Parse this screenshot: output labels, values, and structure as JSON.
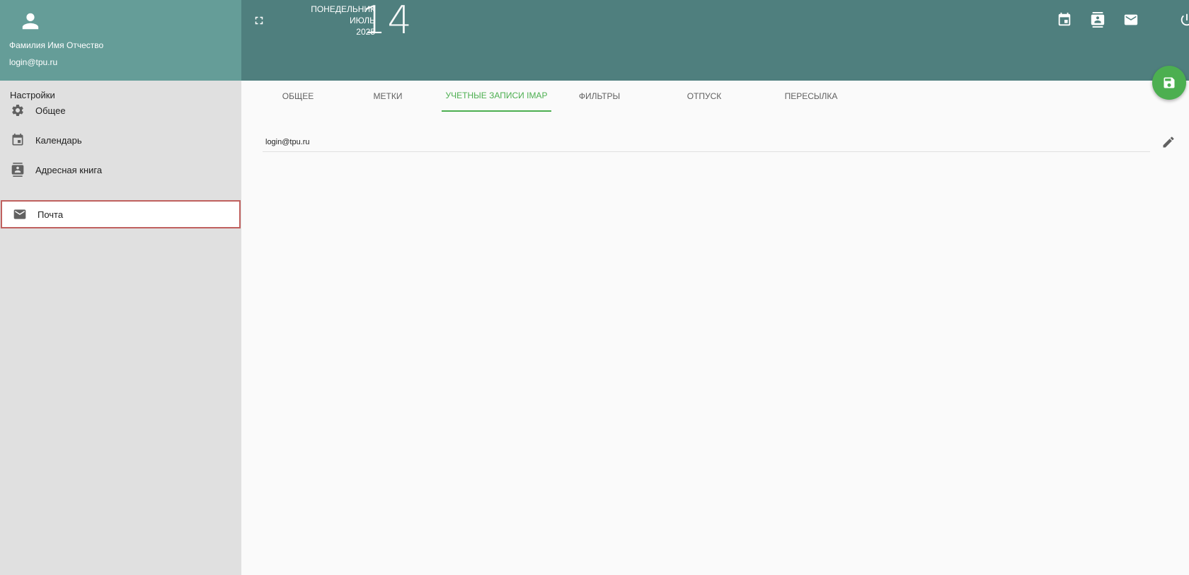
{
  "user": {
    "full_name": "Фамилия Имя Отчество",
    "login": "login@tpu.ru"
  },
  "header": {
    "weekday": "Понедельник",
    "month": "Июль",
    "year": "2025",
    "day": "14",
    "icons": [
      "calendar-icon",
      "address-book-icon",
      "mail-icon",
      "power-icon"
    ]
  },
  "sidebar": {
    "title": "Настройки",
    "items": [
      {
        "label": "Общее",
        "icon": "gear-icon"
      },
      {
        "label": "Календарь",
        "icon": "calendar-icon"
      },
      {
        "label": "Адресная книга",
        "icon": "address-book-icon"
      },
      {
        "label": "Почта",
        "icon": "mail-icon",
        "active": true
      }
    ]
  },
  "tabs": [
    {
      "label": "Общее"
    },
    {
      "label": "Метки"
    },
    {
      "label": "Учетные записи IMAP",
      "active": true
    },
    {
      "label": "Фильтры"
    },
    {
      "label": "Отпуск"
    },
    {
      "label": "Пересылка"
    }
  ],
  "accounts": [
    {
      "email": "login@tpu.ru"
    }
  ],
  "colors": {
    "header": "#4f7f7e",
    "user_panel": "#659d98",
    "accent": "#4caf50",
    "sidebar_bg": "#e0e0e0",
    "active_outline": "#c0605e"
  }
}
